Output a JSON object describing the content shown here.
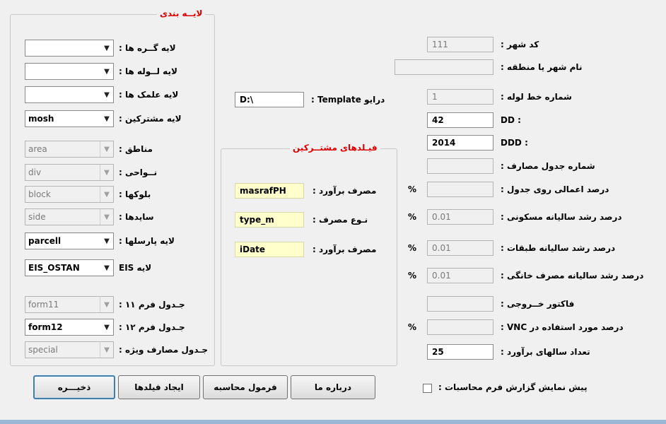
{
  "layers_group": {
    "title": "لایــه بندی",
    "rows": [
      {
        "label": "لایه گــره ها :",
        "value": "",
        "enabled": true
      },
      {
        "label": "لایه لــوله ها :",
        "value": "",
        "enabled": true
      },
      {
        "label": "لایه علمک ها :",
        "value": "",
        "enabled": true
      },
      {
        "label": "لایه مشترکین :",
        "value": "mosh",
        "enabled": true
      },
      {
        "label": "مناطق :",
        "value": "area",
        "enabled": false
      },
      {
        "label": "نــواحی :",
        "value": "div",
        "enabled": false
      },
      {
        "label": "بلوکها :",
        "value": "block",
        "enabled": false
      },
      {
        "label": "سایدها :",
        "value": "side",
        "enabled": false
      },
      {
        "label": "لایه پارسلها :",
        "value": "parcell",
        "enabled": true
      },
      {
        "label": "لایه EIS",
        "value": "EIS_OSTAN",
        "enabled": true
      },
      {
        "label": "جـدول فرم ۱۱ :",
        "value": "form11",
        "enabled": false
      },
      {
        "label": "جـدول فرم ۱۲ :",
        "value": "form12",
        "enabled": true
      },
      {
        "label": "جـدول مصارف ویژه :",
        "value": "special",
        "enabled": false
      }
    ]
  },
  "template": {
    "label": "درایو Template :",
    "value": "D:\\"
  },
  "subscriber_fields": {
    "title": "فیـلدهای مشتــرکین",
    "rows": [
      {
        "label": "مصرف برآورد :",
        "value": "masrafPH"
      },
      {
        "label": "نـوع مصرف :",
        "value": "type_m"
      },
      {
        "label": "مصرف برآورد :",
        "value": "iDate"
      }
    ]
  },
  "right_fields": [
    {
      "label": "کد شهر :",
      "value": "111",
      "enabled": false,
      "pct": ""
    },
    {
      "label": "نام شهر یا منطقه :",
      "value": "",
      "enabled": false,
      "pct": ""
    },
    {
      "label": "شماره خط لوله :",
      "value": "1",
      "enabled": false,
      "pct": ""
    },
    {
      "label": ": DD",
      "value": "42",
      "enabled": true,
      "pct": ""
    },
    {
      "label": ": DDD",
      "value": "2014",
      "enabled": true,
      "pct": ""
    },
    {
      "label": "شماره جدول مصارف :",
      "value": "",
      "enabled": false,
      "pct": ""
    },
    {
      "label": "درصد اعمالی روی جدول :",
      "value": "",
      "enabled": false,
      "pct": "%"
    },
    {
      "label": "درصد رشد سالیانه مسکونی :",
      "value": "0.01",
      "enabled": false,
      "pct": "%"
    },
    {
      "label": "درصد رشد سالیانه طبقات :",
      "value": "0.01",
      "enabled": false,
      "pct": "%"
    },
    {
      "label": "درصد رشد سالیانه مصرف خانگی :",
      "value": "0.01",
      "enabled": false,
      "pct": "%"
    },
    {
      "label": "فاکتور خــروجی :",
      "value": "",
      "enabled": false,
      "pct": ""
    },
    {
      "label": "درصد مورد استفاده در VNC :",
      "value": "",
      "enabled": false,
      "pct": "%"
    },
    {
      "label": "تعداد سالهای برآورد :",
      "value": "25",
      "enabled": true,
      "pct": ""
    }
  ],
  "buttons": {
    "save": "ذخیـــره",
    "create_fields": "ایجاد فیلدها",
    "calc_formula": "فرمول محاسبه",
    "about": "درباره ما"
  },
  "preview_checkbox": {
    "label": "پیش نمایش گزارش فرم محاسبات :",
    "checked": false
  },
  "colors": {
    "title_red": "#e00000",
    "yellow_field": "#ffffcc",
    "default_button_border": "#3c7fb1"
  },
  "icons": {
    "combo_arrow": "▼"
  }
}
